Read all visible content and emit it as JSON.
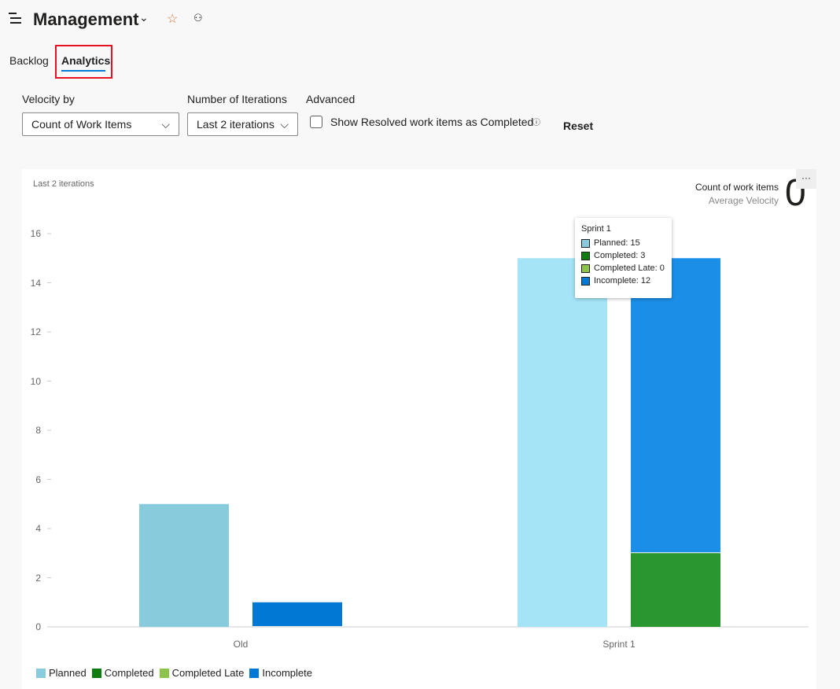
{
  "header": {
    "title": "Management",
    "menu_icon": "hamburger-icon",
    "favorite_icon": "star-icon",
    "team_icon": "people-icon"
  },
  "tabs": [
    {
      "label": "Backlog",
      "active": false
    },
    {
      "label": "Analytics",
      "active": true
    }
  ],
  "filters": {
    "velocity_by": {
      "label": "Velocity by",
      "value": "Count of Work Items"
    },
    "iterations": {
      "label": "Number of Iterations",
      "value": "Last 2 iterations"
    },
    "advanced": {
      "label": "Advanced",
      "checkbox_label": "Show Resolved work items as Completed",
      "checked": false
    },
    "reset": "Reset"
  },
  "widget": {
    "subtitle": "Last 2 iterations",
    "metric_label": "Count of work items",
    "metric_sub": "Average Velocity",
    "metric_value": "0",
    "more": "···"
  },
  "colors": {
    "planned": "#87cbdd",
    "completed": "#107c10",
    "completed_late": "#8cc34a",
    "incomplete": "#0078d4",
    "accent": "#0078d4"
  },
  "tooltip": {
    "title": "Sprint 1",
    "rows": [
      "Planned: 15",
      "Completed: 3",
      "Completed Late: 0",
      "Incomplete: 12"
    ]
  },
  "chart_data": {
    "type": "bar",
    "categories": [
      "Old",
      "Sprint 1"
    ],
    "ylim": [
      0,
      16
    ],
    "yticks": [
      "0",
      "2",
      "4",
      "6",
      "8",
      "10",
      "12",
      "14",
      "16"
    ],
    "grid": false,
    "legend_placement": "bottom-left",
    "series": [
      {
        "name": "Planned",
        "values": [
          5,
          15
        ]
      },
      {
        "name": "Completed",
        "values": [
          0,
          3
        ]
      },
      {
        "name": "Completed Late",
        "values": [
          0,
          0
        ]
      },
      {
        "name": "Incomplete",
        "values": [
          1,
          12
        ]
      }
    ]
  }
}
